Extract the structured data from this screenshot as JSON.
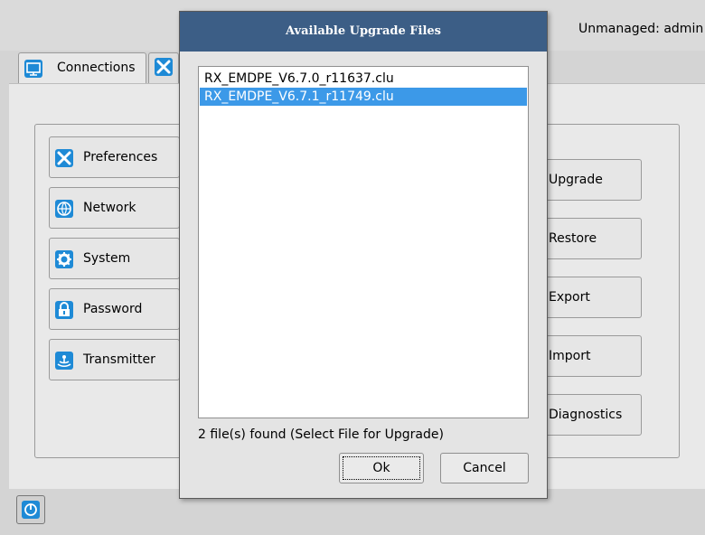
{
  "header": {
    "status": "Unmanaged: admin"
  },
  "tabs": [
    {
      "label": "Connections",
      "icon": "monitor-icon"
    },
    {
      "label": "",
      "icon": "tools-icon"
    }
  ],
  "left_buttons": [
    {
      "label": "Preferences",
      "icon": "tools-icon"
    },
    {
      "label": "Network",
      "icon": "globe-icon"
    },
    {
      "label": "System",
      "icon": "gear-icon"
    },
    {
      "label": "Password",
      "icon": "lock-icon"
    },
    {
      "label": "Transmitter",
      "icon": "broadcast-icon"
    }
  ],
  "right_buttons": [
    {
      "label": "Upgrade"
    },
    {
      "label": "Restore"
    },
    {
      "label": "Export"
    },
    {
      "label": "Import"
    },
    {
      "label": "Diagnostics"
    }
  ],
  "dialog": {
    "title": "Available Upgrade Files",
    "files": [
      {
        "name": "RX_EMDPE_V6.7.0_r11637.clu",
        "selected": false
      },
      {
        "name": "RX_EMDPE_V6.7.1_r11749.clu",
        "selected": true
      }
    ],
    "status": "2 file(s) found (Select File for Upgrade)",
    "ok_label": "Ok",
    "cancel_label": "Cancel"
  },
  "colors": {
    "accent": "#1e8ad6",
    "title_bar": "#3c5e86",
    "selection": "#3c99e8"
  }
}
